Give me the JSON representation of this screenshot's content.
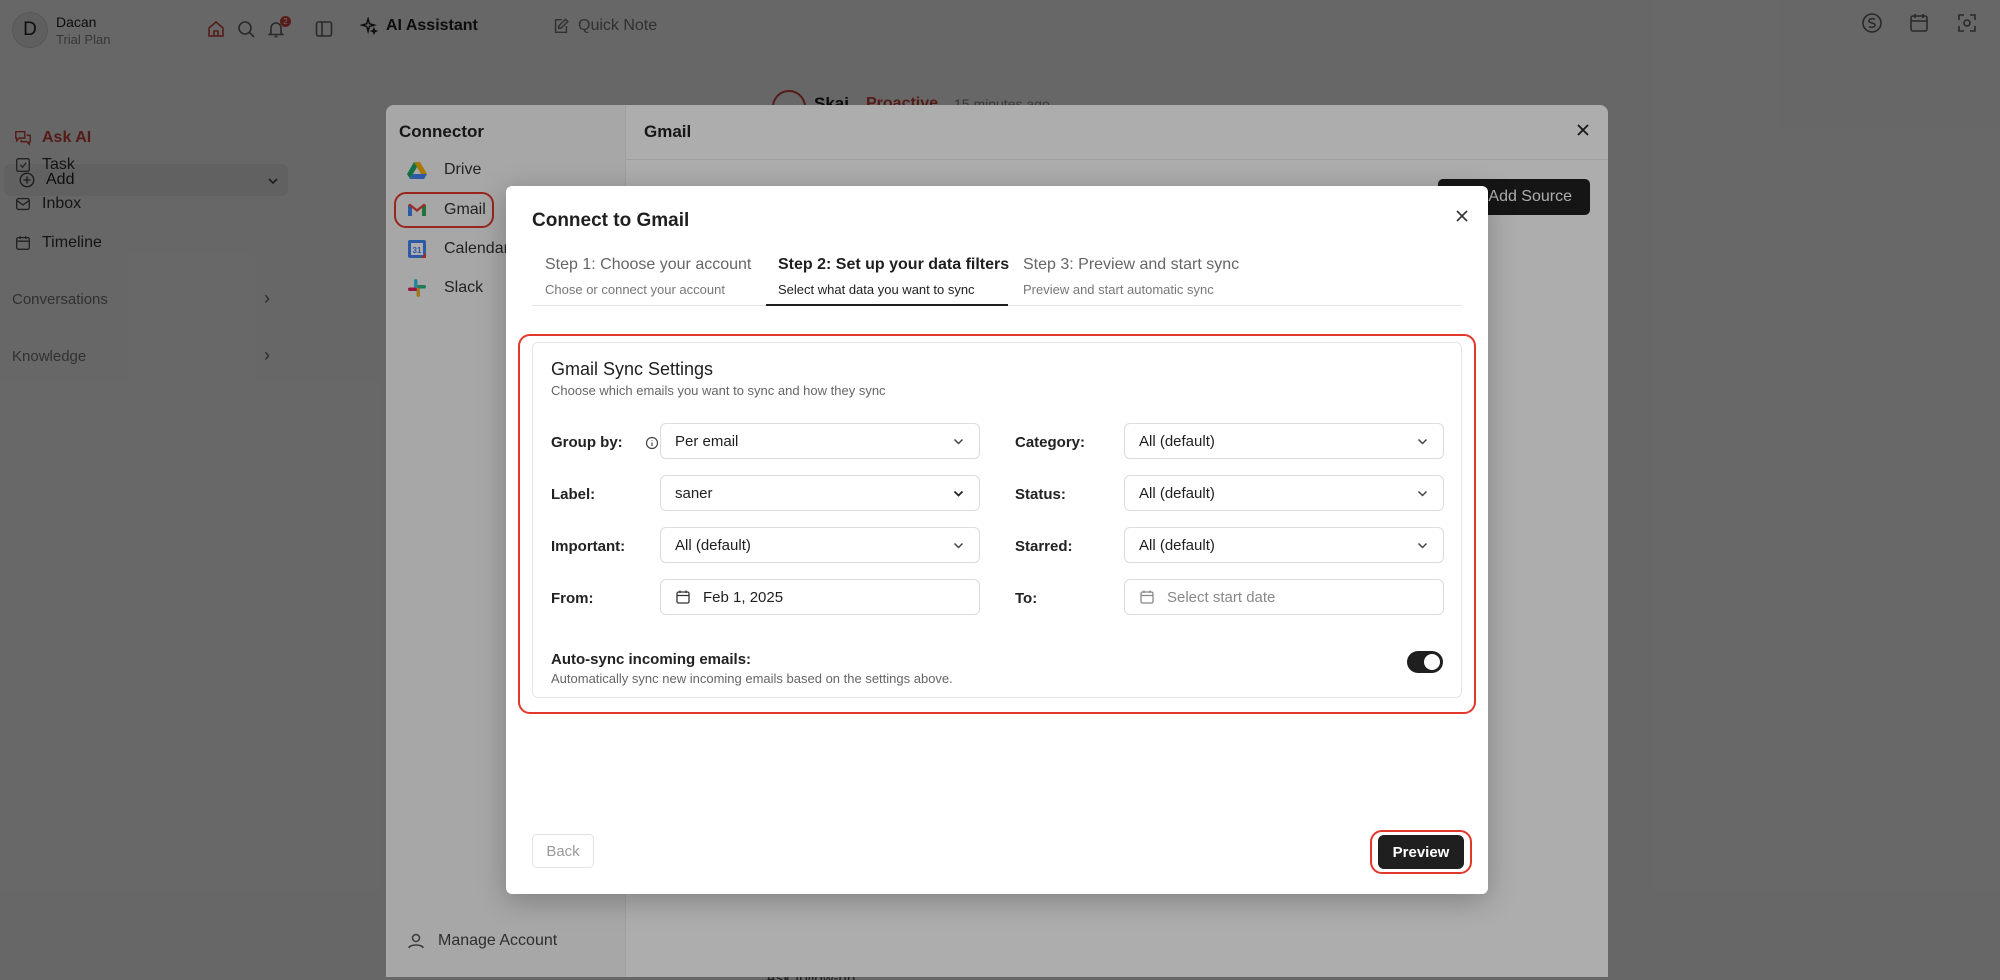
{
  "topbar": {
    "avatar_letter": "D",
    "user_name": "Dacan",
    "user_plan": "Trial Plan",
    "notification_count": "2",
    "tab_ai": "AI Assistant",
    "tab_note": "Quick Note",
    "icons": [
      "home-icon",
      "search-icon",
      "bell-icon",
      "sidebar-toggle-icon",
      "s-circle-icon",
      "calendar-icon",
      "focus-icon"
    ]
  },
  "sidebar": {
    "ask_ai": "Ask AI",
    "add": "Add",
    "items": [
      {
        "label": "Task",
        "icon": "checkbox-icon"
      },
      {
        "label": "Inbox",
        "icon": "inbox-icon"
      },
      {
        "label": "Timeline",
        "icon": "calendar-icon"
      }
    ],
    "conversations": "Conversations",
    "knowledge": "Knowledge"
  },
  "background": {
    "frag1": "Skai",
    "frag2": "Proactive",
    "frag3": "15 minutes ago",
    "frag4": "Ask follow-up"
  },
  "connector": {
    "title": "Connector",
    "items": [
      {
        "label": "Drive",
        "icon": "google-drive-icon"
      },
      {
        "label": "Gmail",
        "icon": "gmail-icon"
      },
      {
        "label": "Calendar",
        "icon": "google-calendar-icon"
      },
      {
        "label": "Slack",
        "icon": "slack-icon"
      }
    ],
    "manage_account": "Manage Account",
    "panel_title": "Gmail",
    "add_source": "Add Source"
  },
  "modal": {
    "title": "Connect to Gmail",
    "steps": [
      {
        "title": "Step 1: Choose your account",
        "sub": "Chose or connect your account"
      },
      {
        "title": "Step 2: Set up your data filters",
        "sub": "Select what data you want to sync"
      },
      {
        "title": "Step 3: Preview and start sync",
        "sub": "Preview and start automatic sync"
      }
    ],
    "active_step": 2,
    "settings": {
      "title": "Gmail Sync Settings",
      "subtitle": "Choose which emails you want to sync and how they sync",
      "group_by_label": "Group by:",
      "group_by_value": "Per email",
      "category_label": "Category:",
      "category_value": "All (default)",
      "label_label": "Label:",
      "label_value": "saner",
      "status_label": "Status:",
      "status_value": "All (default)",
      "important_label": "Important:",
      "important_value": "All (default)",
      "starred_label": "Starred:",
      "starred_value": "All (default)",
      "from_label": "From:",
      "from_value": "Feb 1, 2025",
      "to_label": "To:",
      "to_placeholder": "Select start date",
      "autosync_label": "Auto-sync incoming emails:",
      "autosync_sub": "Automatically sync new incoming emails based on the settings above.",
      "autosync_on": true
    },
    "back": "Back",
    "preview": "Preview"
  }
}
